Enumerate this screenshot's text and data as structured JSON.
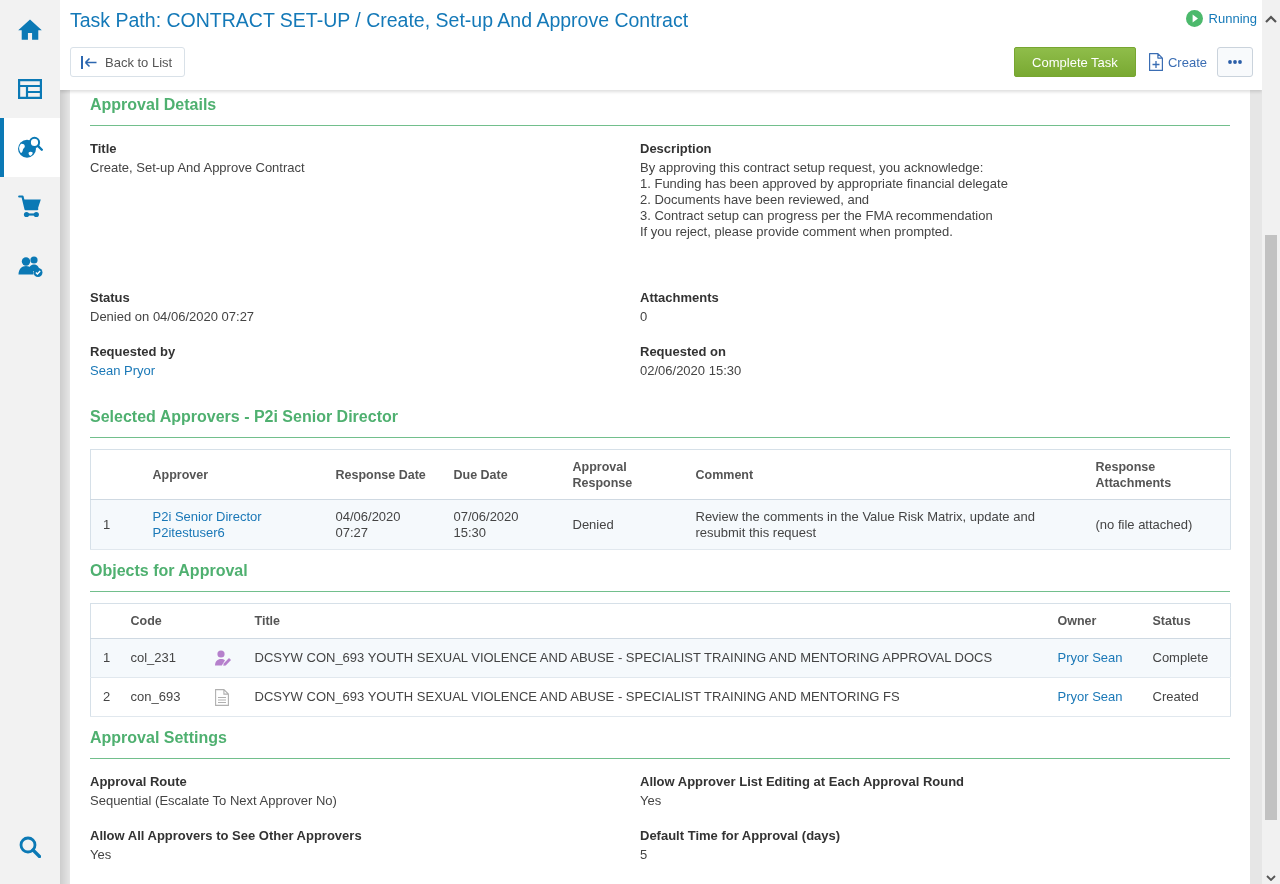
{
  "sidebar": {
    "items": [
      {
        "selected": false
      },
      {
        "selected": false
      },
      {
        "selected": true
      },
      {
        "selected": false
      },
      {
        "selected": false
      }
    ]
  },
  "header": {
    "title": "Task Path: CONTRACT SET-UP / Create, Set-up And Approve Contract",
    "status": "Running",
    "back_button": "Back to List",
    "complete_button": "Complete Task",
    "create_button": "Create"
  },
  "approval_details": {
    "heading": "Approval Details",
    "fields": [
      {
        "label": "Title",
        "value": "Create, Set-up And Approve Contract",
        "kind": "text"
      },
      {
        "label": "Description",
        "value": "By approving this contract setup request, you acknowledge:\n1. Funding has been approved by appropriate financial delegate\n2. Documents have been reviewed, and\n3. Contract setup can progress per the FMA recommendation\nIf you reject, please provide comment when prompted.",
        "kind": "paragraph"
      },
      {
        "label": "Status",
        "value": "Denied on 04/06/2020 07:27",
        "kind": "text"
      },
      {
        "label": "Attachments",
        "value": "0",
        "kind": "text"
      },
      {
        "label": "Requested by",
        "value": "Sean Pryor",
        "kind": "link"
      },
      {
        "label": "Requested on",
        "value": "02/06/2020 15:30",
        "kind": "text"
      }
    ]
  },
  "approvers": {
    "heading": "Selected Approvers - P2i Senior Director",
    "columns": [
      "Approver",
      "Response Date",
      "Due Date",
      "Approval Response",
      "Comment",
      "Response Attachments"
    ],
    "rows": [
      {
        "number": "1",
        "approver": "P2i Senior Director",
        "approver_user": "P2itestuser6",
        "response_date": "04/06/2020 07:27",
        "due_date": "07/06/2020 15:30",
        "response": "Denied",
        "comment": "Review the comments in the Value Risk Matrix, update and resubmit this request",
        "attachments": "(no file attached)"
      }
    ]
  },
  "objects": {
    "heading": "Objects for Approval",
    "columns": [
      "Code",
      "Title",
      "Owner",
      "Status"
    ],
    "rows": [
      {
        "number": "1",
        "code": "col_231",
        "kind": "person",
        "title": "DCSYW CON_693 YOUTH SEXUAL VIOLENCE AND ABUSE - SPECIALIST TRAINING AND MENTORING APPROVAL DOCS",
        "owner": "Pryor Sean",
        "status": "Complete"
      },
      {
        "number": "2",
        "code": "con_693",
        "kind": "document",
        "title": "DCSYW CON_693 YOUTH SEXUAL VIOLENCE AND ABUSE - SPECIALIST TRAINING AND MENTORING FS",
        "owner": "Pryor Sean",
        "status": "Created"
      }
    ]
  },
  "approval_settings": {
    "heading": "Approval Settings",
    "fields": [
      {
        "label": "Approval Route",
        "value": "Sequential (Escalate To Next Approver No)",
        "kind": "text"
      },
      {
        "label": "Allow Approver List Editing at Each Approval Round",
        "value": "Yes",
        "kind": "text"
      },
      {
        "label": "Allow All Approvers to See Other Approvers",
        "value": "Yes",
        "kind": "text"
      },
      {
        "label": "Default Time for Approval (days)",
        "value": "5",
        "kind": "text"
      }
    ]
  }
}
